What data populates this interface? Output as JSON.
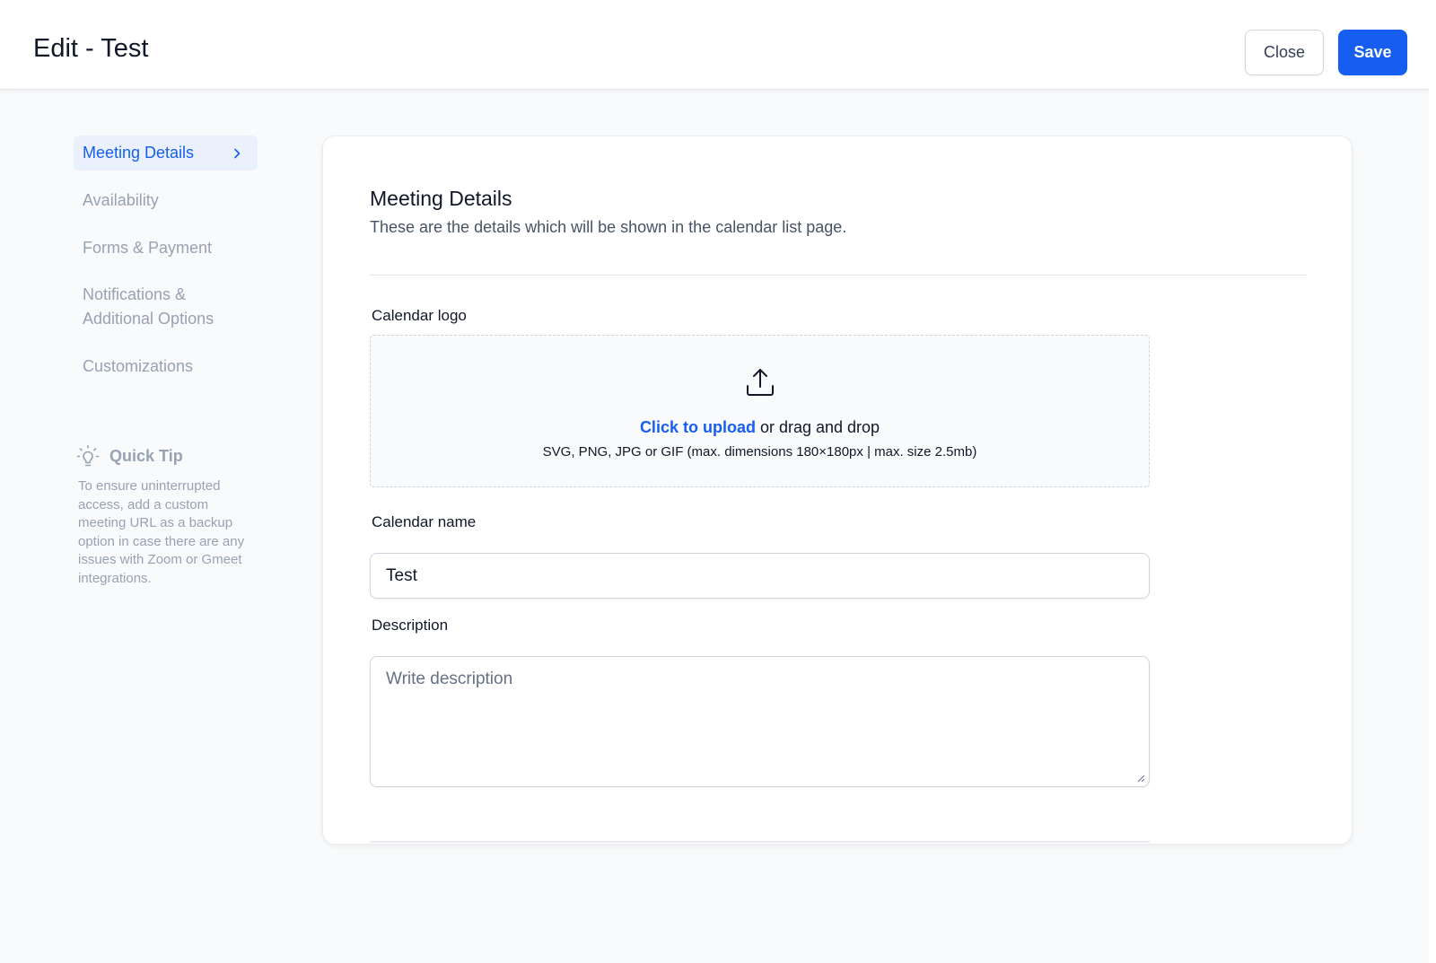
{
  "header": {
    "title": "Edit - Test",
    "close_label": "Close",
    "save_label": "Save",
    "accent_color": "#155eef"
  },
  "sidebar": {
    "items": [
      {
        "label": "Meeting Details",
        "active": true
      },
      {
        "label": "Availability",
        "active": false
      },
      {
        "label": "Forms & Payment",
        "active": false
      },
      {
        "label": "Notifications & Additional Options",
        "active": false
      },
      {
        "label": "Customizations",
        "active": false
      }
    ],
    "tip": {
      "icon": "lightbulb-icon",
      "title": "Quick Tip",
      "text": "To ensure uninterrupted access, add a custom meeting URL as a backup option in case there are any issues with Zoom or Gmeet integrations."
    }
  },
  "main": {
    "title": "Meeting Details",
    "subtitle": "These are the details which will be shown in the calendar list page.",
    "logo": {
      "label": "Calendar logo",
      "icon": "upload-icon",
      "link_text": "Click to upload",
      "drag_text": " or drag and drop",
      "hint": "SVG, PNG, JPG or GIF (max. dimensions 180×180px | max. size 2.5mb)"
    },
    "name": {
      "label": "Calendar name",
      "value": "Test"
    },
    "description": {
      "label": "Description",
      "value": "",
      "placeholder": "Write description"
    }
  }
}
